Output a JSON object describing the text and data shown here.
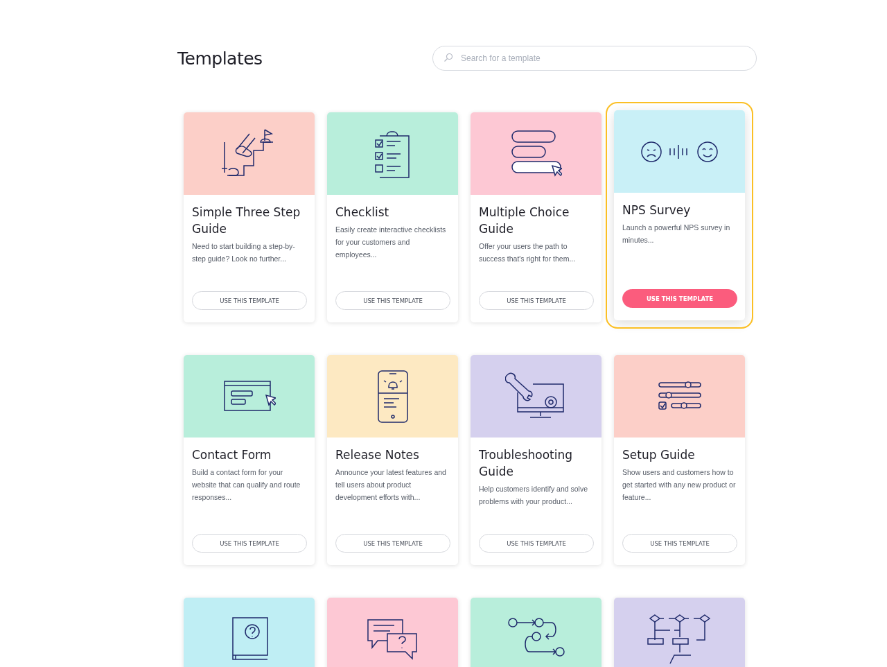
{
  "page_title": "Templates",
  "search": {
    "placeholder": "Search for a template"
  },
  "cards": [
    {
      "kind": "steps",
      "color": "#fccfc8",
      "title": "Simple Three Step Guide",
      "description": "Need to start building a step-by-step guide? Look no further...",
      "button": "USE THIS TEMPLATE",
      "selected": false
    },
    {
      "kind": "checklist",
      "color": "#b8eedb",
      "title": "Checklist",
      "description": "Easily create interactive checklists for your customers and employees...",
      "button": "USE THIS TEMPLATE",
      "selected": false
    },
    {
      "kind": "choices",
      "color": "#fdc8d4",
      "title": "Multiple Choice Guide",
      "description": "Offer your users the path to success that's right for them...",
      "button": "USE THIS TEMPLATE",
      "selected": false
    },
    {
      "kind": "nps",
      "color": "#c9f0f7",
      "title": "NPS Survey",
      "description": "Launch a powerful NPS survey in minutes...",
      "button": "USE THIS TEMPLATE",
      "selected": true
    },
    {
      "kind": "form",
      "color": "#b8eedb",
      "title": "Contact Form",
      "description": "Build a contact form for your website that can qualify and route responses...",
      "button": "USE THIS TEMPLATE",
      "selected": false
    },
    {
      "kind": "phone",
      "color": "#fde9c2",
      "title": "Release Notes",
      "description": "Announce your latest features and tell users about product development efforts with...",
      "button": "USE THIS TEMPLATE",
      "selected": false
    },
    {
      "kind": "wrench",
      "color": "#d5d0ee",
      "title": "Troubleshooting Guide",
      "description": "Help customers identify and solve problems with your product...",
      "button": "USE THIS TEMPLATE",
      "selected": false
    },
    {
      "kind": "sliders",
      "color": "#fccfc8",
      "title": "Setup Guide",
      "description": "Show users and customers how to get started with any new product or feature...",
      "button": "USE THIS TEMPLATE",
      "selected": false
    },
    {
      "kind": "book",
      "color": "#bfeef4",
      "selected": false
    },
    {
      "kind": "chat",
      "color": "#fdc8d4",
      "selected": false
    },
    {
      "kind": "flow",
      "color": "#b8eedb",
      "selected": false
    },
    {
      "kind": "diagram",
      "color": "#d5d0ee",
      "selected": false
    }
  ]
}
